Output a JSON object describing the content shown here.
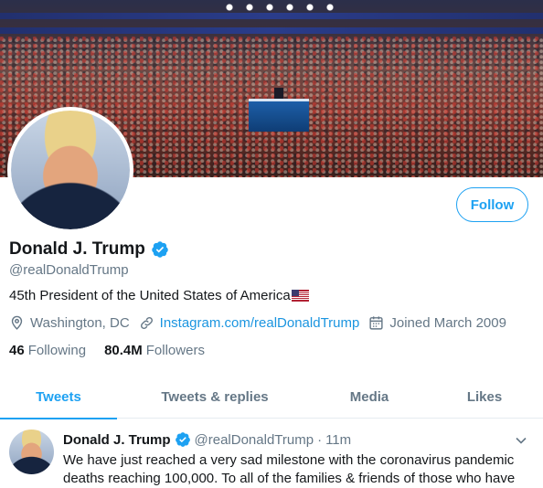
{
  "profile": {
    "display_name": "Donald J. Trump",
    "handle": "@realDonaldTrump",
    "bio": "45th President of the United States of America",
    "bio_emoji": "us-flag-icon",
    "location": "Washington, DC",
    "website": "Instagram.com/realDonaldTrump",
    "joined": "Joined March 2009",
    "following_count": "46",
    "following_label": "Following",
    "followers_count": "80.4M",
    "followers_label": "Followers",
    "follow_button": "Follow",
    "verified": true
  },
  "tabs": [
    {
      "label": "Tweets",
      "active": true
    },
    {
      "label": "Tweets & replies",
      "active": false
    },
    {
      "label": "Media",
      "active": false
    },
    {
      "label": "Likes",
      "active": false
    }
  ],
  "tweet": {
    "name": "Donald J. Trump",
    "handle": "@realDonaldTrump",
    "separator": "·",
    "time": "11m",
    "text_line1": "We have just reached a very sad milestone with the coronavirus pandemic",
    "text_line2": "deaths reaching 100,000. To all of the families & friends of those who have"
  },
  "colors": {
    "accent": "#1da1f2",
    "link": "#1b95e0",
    "secondary_text": "#657786",
    "primary_text": "#14171a"
  }
}
